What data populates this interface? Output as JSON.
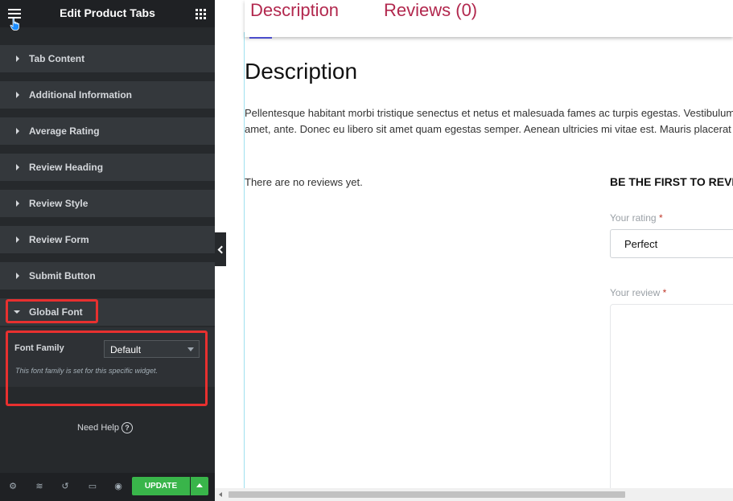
{
  "sidebar": {
    "title": "Edit Product Tabs",
    "sections": [
      {
        "label": "Tab Content"
      },
      {
        "label": "Additional Information"
      },
      {
        "label": "Average Rating"
      },
      {
        "label": "Review Heading"
      },
      {
        "label": "Review Style"
      },
      {
        "label": "Review Form"
      },
      {
        "label": "Submit Button"
      }
    ],
    "global_font": {
      "label": "Global Font",
      "font_family_label": "Font Family",
      "font_family_value": "Default",
      "description": "This font family is set for this specific widget."
    },
    "help_label": "Need Help",
    "update_label": "UPDATE"
  },
  "preview": {
    "tabs": [
      {
        "label": "Description"
      },
      {
        "label": "Reviews (0)"
      }
    ],
    "heading": "Description",
    "paragraph_line1": "Pellentesque habitant morbi tristique senectus et netus et malesuada fames ac turpis egestas. Vestibulum tortor quam, feugiat vitae, ultricies eget, tempor sit",
    "paragraph_line2": "amet, ante. Donec eu libero sit amet quam egestas semper. Aenean ultricies mi vitae est. Mauris placerat eleifend leo.",
    "no_reviews": "There are no reviews yet.",
    "first_review": "BE THE FIRST TO REVIEW",
    "rating_label": "Your rating",
    "rating_value": "Perfect",
    "review_label": "Your review",
    "required_mark": "*"
  },
  "colors": {
    "accent_tab": "#b2284e",
    "update_green": "#39b54a",
    "highlight_red": "#e8302f"
  }
}
